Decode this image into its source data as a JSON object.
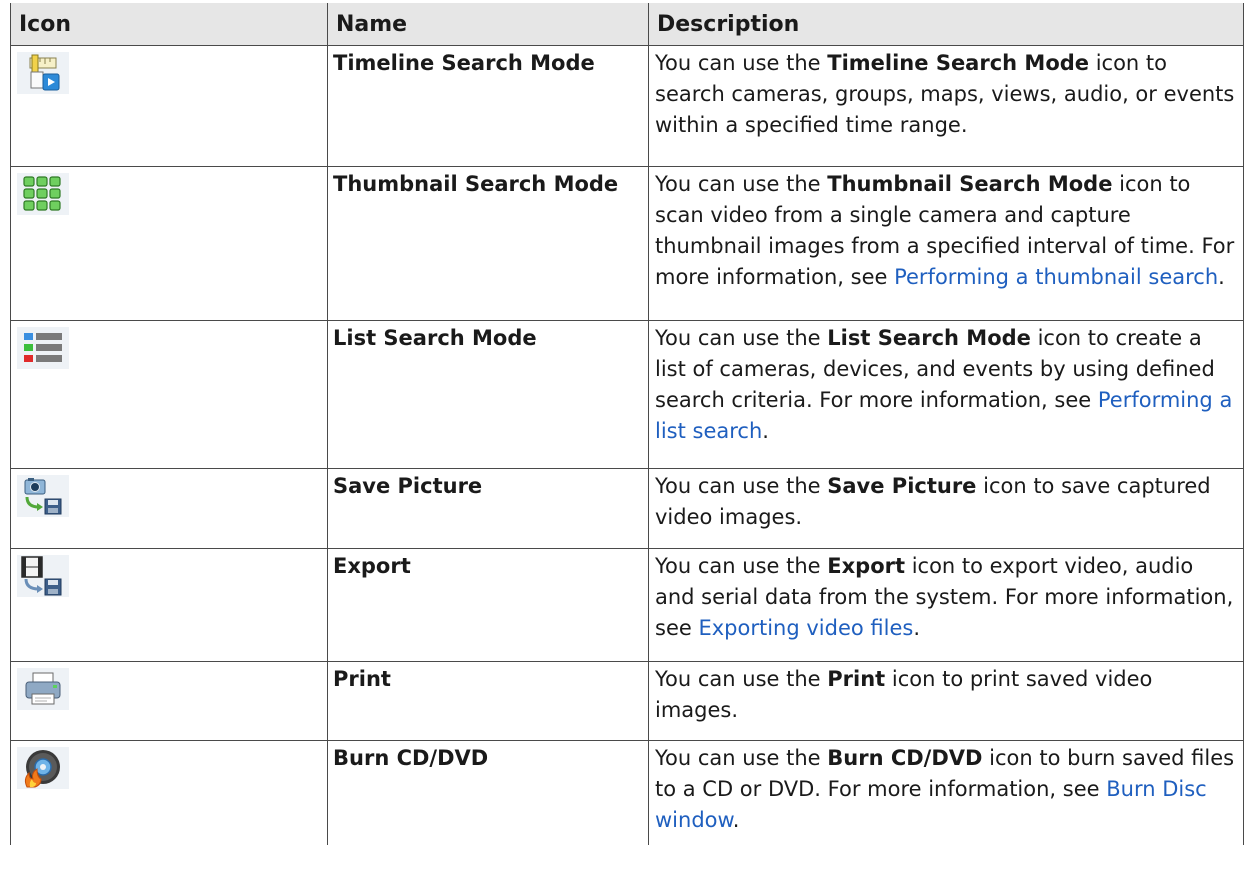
{
  "headers": {
    "icon": "Icon",
    "name": "Name",
    "description": "Description"
  },
  "rows": [
    {
      "icon": "timeline-search-icon",
      "name": "Timeline Search Mode",
      "desc_before": "You can use the ",
      "desc_bold": "Timeline Search Mode",
      "desc_after": " icon to search cameras, groups, maps, views, audio, or events within a specified time range."
    },
    {
      "icon": "thumbnail-search-icon",
      "name": "Thumbnail Search Mode",
      "desc_before": "You can use the ",
      "desc_bold": "Thumbnail Search Mode",
      "desc_after": " icon to scan video from a single camera and capture thumbnail images from a specified interval of time. For more information, see ",
      "link": "Performing a thumbnail search",
      "desc_end": "."
    },
    {
      "icon": "list-search-icon",
      "name": "List Search Mode",
      "desc_before": "You can use the ",
      "desc_bold": "List Search Mode",
      "desc_after": " icon to create a list of cameras, devices, and events by using defined search criteria. For more information, see ",
      "link": "Performing a list search",
      "desc_end": "."
    },
    {
      "icon": "save-picture-icon",
      "name": "Save Picture",
      "desc_before": "You can use the ",
      "desc_bold": "Save Picture",
      "desc_after": " icon to save captured video images."
    },
    {
      "icon": "export-icon",
      "name": "Export",
      "desc_before": "You can use the ",
      "desc_bold": "Export",
      "desc_after": " icon to export video, audio and serial data from the system. For more information, see ",
      "link": "Exporting video files",
      "desc_end": "."
    },
    {
      "icon": "print-icon",
      "name": "Print",
      "desc_before": "You can use the ",
      "desc_bold": "Print",
      "desc_after": " icon to print saved video images."
    },
    {
      "icon": "burn-disc-icon",
      "name": "Burn CD/DVD",
      "desc_before": "You can use the ",
      "desc_bold": "Burn CD/DVD",
      "desc_after": " icon to burn saved files to a CD or DVD. For more information, see ",
      "link": "Burn Disc window",
      "desc_end": "."
    }
  ]
}
